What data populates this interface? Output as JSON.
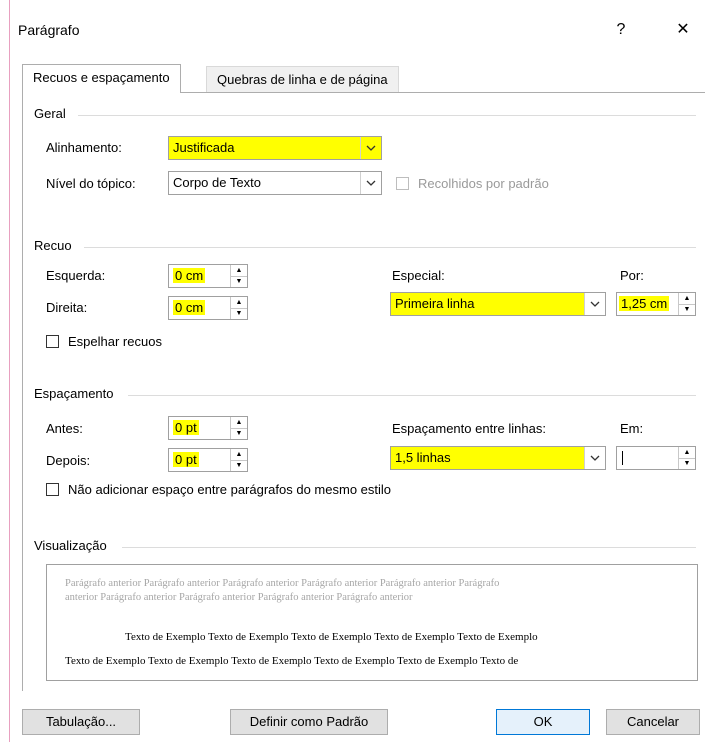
{
  "window": {
    "title": "Parágrafo",
    "help_label": "?",
    "close_label": "✕"
  },
  "tabs": [
    {
      "label": "Recuos e espaçamento"
    },
    {
      "label": "Quebras de linha e de página"
    }
  ],
  "geral": {
    "title": "Geral",
    "alinhamento_label": "Alinhamento:",
    "alinhamento_value": "Justificada",
    "nivel_label": "Nível do tópico:",
    "nivel_value": "Corpo de Texto",
    "recolhidos_label": "Recolhidos por padrão"
  },
  "recuo": {
    "title": "Recuo",
    "esquerda_label": "Esquerda:",
    "esquerda_value": "0 cm",
    "direita_label": "Direita:",
    "direita_value": "0 cm",
    "especial_label": "Especial:",
    "especial_value": "Primeira linha",
    "por_label": "Por:",
    "por_value": "1,25 cm",
    "espelhar_label": "Espelhar recuos"
  },
  "espacamento": {
    "title": "Espaçamento",
    "antes_label": "Antes:",
    "antes_value": "0 pt",
    "depois_label": "Depois:",
    "depois_value": "0 pt",
    "entre_linhas_label": "Espaçamento entre linhas:",
    "entre_linhas_value": "1,5 linhas",
    "em_label": "Em:",
    "em_value": "",
    "nao_adicionar_label": "Não adicionar espaço entre parágrafos do mesmo estilo"
  },
  "visualizacao": {
    "title": "Visualização",
    "prev_line1": "Parágrafo anterior Parágrafo anterior Parágrafo anterior Parágrafo anterior Parágrafo anterior Parágrafo",
    "prev_line2": "anterior Parágrafo anterior Parágrafo anterior Parágrafo anterior Parágrafo anterior",
    "sample_line1": "Texto de Exemplo Texto de Exemplo Texto de Exemplo Texto de Exemplo Texto de Exemplo",
    "sample_line2": "Texto de Exemplo Texto de Exemplo Texto de Exemplo Texto de Exemplo Texto de Exemplo Texto de"
  },
  "buttons": {
    "tabulacao": "Tabulação...",
    "definir_padrao": "Definir como Padrão",
    "ok": "OK",
    "cancelar": "Cancelar"
  },
  "colors": {
    "highlight": "#ffff00",
    "accent": "#0078d7"
  }
}
